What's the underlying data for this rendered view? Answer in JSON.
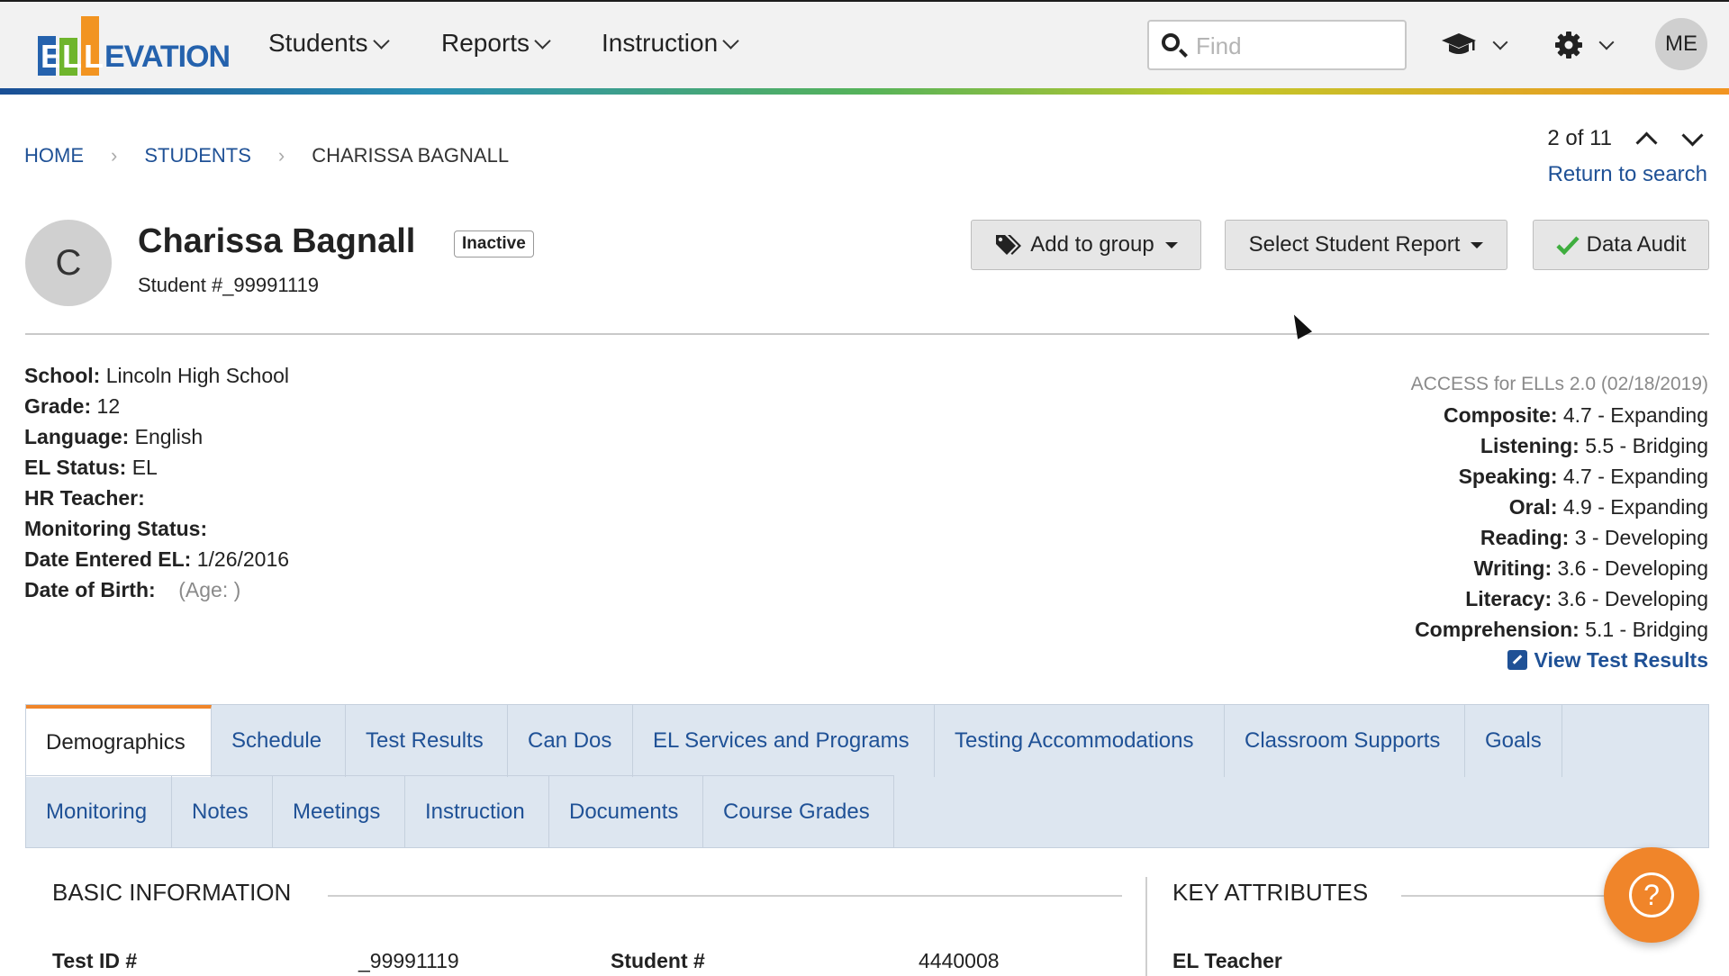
{
  "brand": {
    "logo_letters": [
      "E",
      "L",
      "L",
      "EVATION"
    ],
    "colors": {
      "primary": "#1f5196",
      "accent": "#f0852a",
      "logo_blue": "#2562ad",
      "logo_green": "#6fb52c",
      "logo_orange": "#f29421"
    }
  },
  "nav": {
    "students": "Students",
    "reports": "Reports",
    "instruction": "Instruction",
    "search_placeholder": "Find",
    "user_initials": "ME"
  },
  "breadcrumb": {
    "home": "HOME",
    "students": "STUDENTS",
    "current": "CHARISSA BAGNALL"
  },
  "pager": {
    "position": "2 of 11",
    "return": "Return to search"
  },
  "student": {
    "initial": "C",
    "name": "Charissa Bagnall",
    "status": "Inactive",
    "number": "Student #_99991119"
  },
  "actions": {
    "add_group": "Add to group",
    "select_report": "Select Student Report",
    "data_audit": "Data Audit"
  },
  "info": [
    {
      "label": "School:",
      "value": "Lincoln High School"
    },
    {
      "label": "Grade:",
      "value": "12"
    },
    {
      "label": "Language:",
      "value": "English"
    },
    {
      "label": "EL Status:",
      "value": "EL"
    },
    {
      "label": "HR Teacher:",
      "value": ""
    },
    {
      "label": "Monitoring Status:",
      "value": ""
    },
    {
      "label": "Date Entered EL:",
      "value": "1/26/2016"
    },
    {
      "label": "Date of Birth:",
      "value": "",
      "note": "(Age: )"
    }
  ],
  "access": {
    "header": "ACCESS for ELLs 2.0 (02/18/2019)",
    "scores": [
      {
        "label": "Composite:",
        "value": "4.7 - Expanding"
      },
      {
        "label": "Listening:",
        "value": "5.5 - Bridging"
      },
      {
        "label": "Speaking:",
        "value": "4.7 - Expanding"
      },
      {
        "label": "Oral:",
        "value": "4.9 - Expanding"
      },
      {
        "label": "Reading:",
        "value": "3 - Developing"
      },
      {
        "label": "Writing:",
        "value": "3.6 - Developing"
      },
      {
        "label": "Literacy:",
        "value": "3.6 - Developing"
      },
      {
        "label": "Comprehension:",
        "value": "5.1 - Bridging"
      }
    ],
    "view_link": "View Test Results"
  },
  "tabs": {
    "row1": [
      "Demographics",
      "Schedule",
      "Test Results",
      "Can Dos",
      "EL Services and Programs",
      "Testing Accommodations",
      "Classroom Supports",
      "Goals"
    ],
    "row2": [
      "Monitoring",
      "Notes",
      "Meetings",
      "Instruction",
      "Documents",
      "Course Grades"
    ]
  },
  "basic": {
    "title": "BASIC INFORMATION",
    "test_id_label": "Test ID #",
    "test_id_value": "_99991119",
    "student_label": "Student #",
    "student_value": "4440008"
  },
  "key": {
    "title": "KEY ATTRIBUTES",
    "el_teacher_label": "EL Teacher"
  },
  "help": {
    "symbol": "?"
  }
}
